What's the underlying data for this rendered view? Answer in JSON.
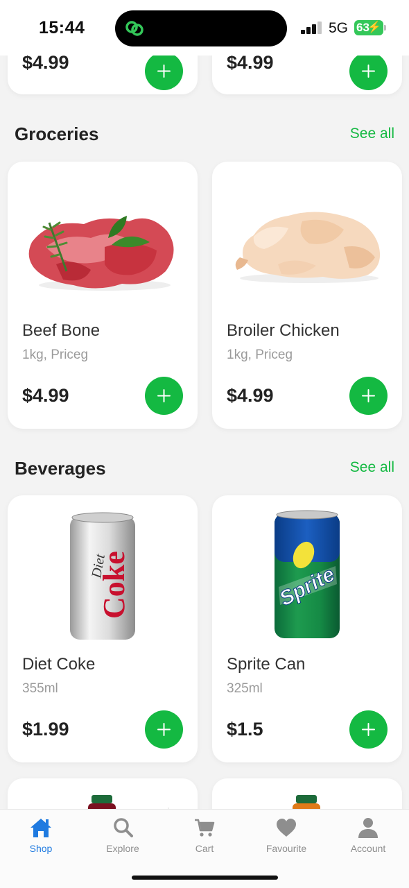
{
  "status_bar": {
    "time": "15:44",
    "network": "5G",
    "battery": "63"
  },
  "top_row": [
    {
      "price": "$4.99"
    },
    {
      "price": "$4.99"
    }
  ],
  "sections": [
    {
      "title": "Groceries",
      "see_all": "See all",
      "items": [
        {
          "name": "Beef Bone",
          "subtitle": "1kg, Priceg",
          "price": "$4.99"
        },
        {
          "name": "Broiler Chicken",
          "subtitle": "1kg, Priceg",
          "price": "$4.99"
        }
      ]
    },
    {
      "title": "Beverages",
      "see_all": "See all",
      "items": [
        {
          "name": "Diet Coke",
          "subtitle": "355ml",
          "price": "$1.99",
          "can_text": "Coke",
          "can_script": "Diet"
        },
        {
          "name": "Sprite Can",
          "subtitle": "325ml",
          "price": "$1.5",
          "can_text": "Sprite"
        }
      ]
    }
  ],
  "tabs": [
    {
      "label": "Shop",
      "icon": "home-icon",
      "active": true
    },
    {
      "label": "Explore",
      "icon": "search-icon",
      "active": false
    },
    {
      "label": "Cart",
      "icon": "cart-icon",
      "active": false
    },
    {
      "label": "Favourite",
      "icon": "heart-icon",
      "active": false
    },
    {
      "label": "Account",
      "icon": "person-icon",
      "active": false
    }
  ],
  "colors": {
    "accent": "#14b942",
    "active_tab": "#1f7ae0",
    "inactive_tab": "#8e8e8e"
  }
}
